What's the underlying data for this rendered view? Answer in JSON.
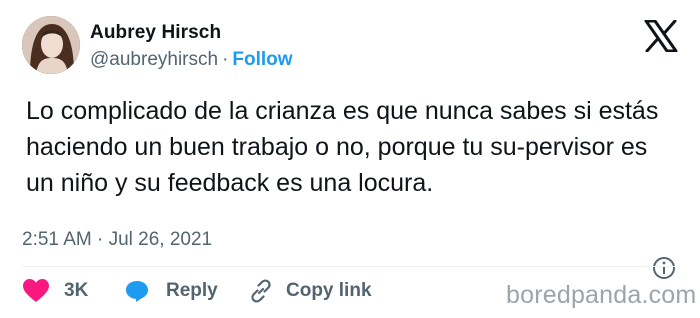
{
  "author": {
    "name": "Aubrey Hirsch",
    "handle": "@aubreyhirsch",
    "separator": "·",
    "follow_label": "Follow"
  },
  "brand": {
    "icon": "x-logo-icon"
  },
  "tweet": {
    "text": "Lo complicado de la crianza es que nunca sabes si estás haciendo un buen trabajo o no, porque tu su-pervisor es un niño y su feedback es una locura.",
    "timestamp": "2:51 AM · Jul 26, 2021"
  },
  "actions": {
    "like_count": "3K",
    "reply_label": "Reply",
    "copy_link_label": "Copy link"
  },
  "watermark": "boredpanda.com",
  "colors": {
    "accent": "#1d9bf0",
    "heart": "#f91880",
    "text": "#0f1419",
    "muted": "#536471",
    "watermark": "#9aa5ac"
  }
}
